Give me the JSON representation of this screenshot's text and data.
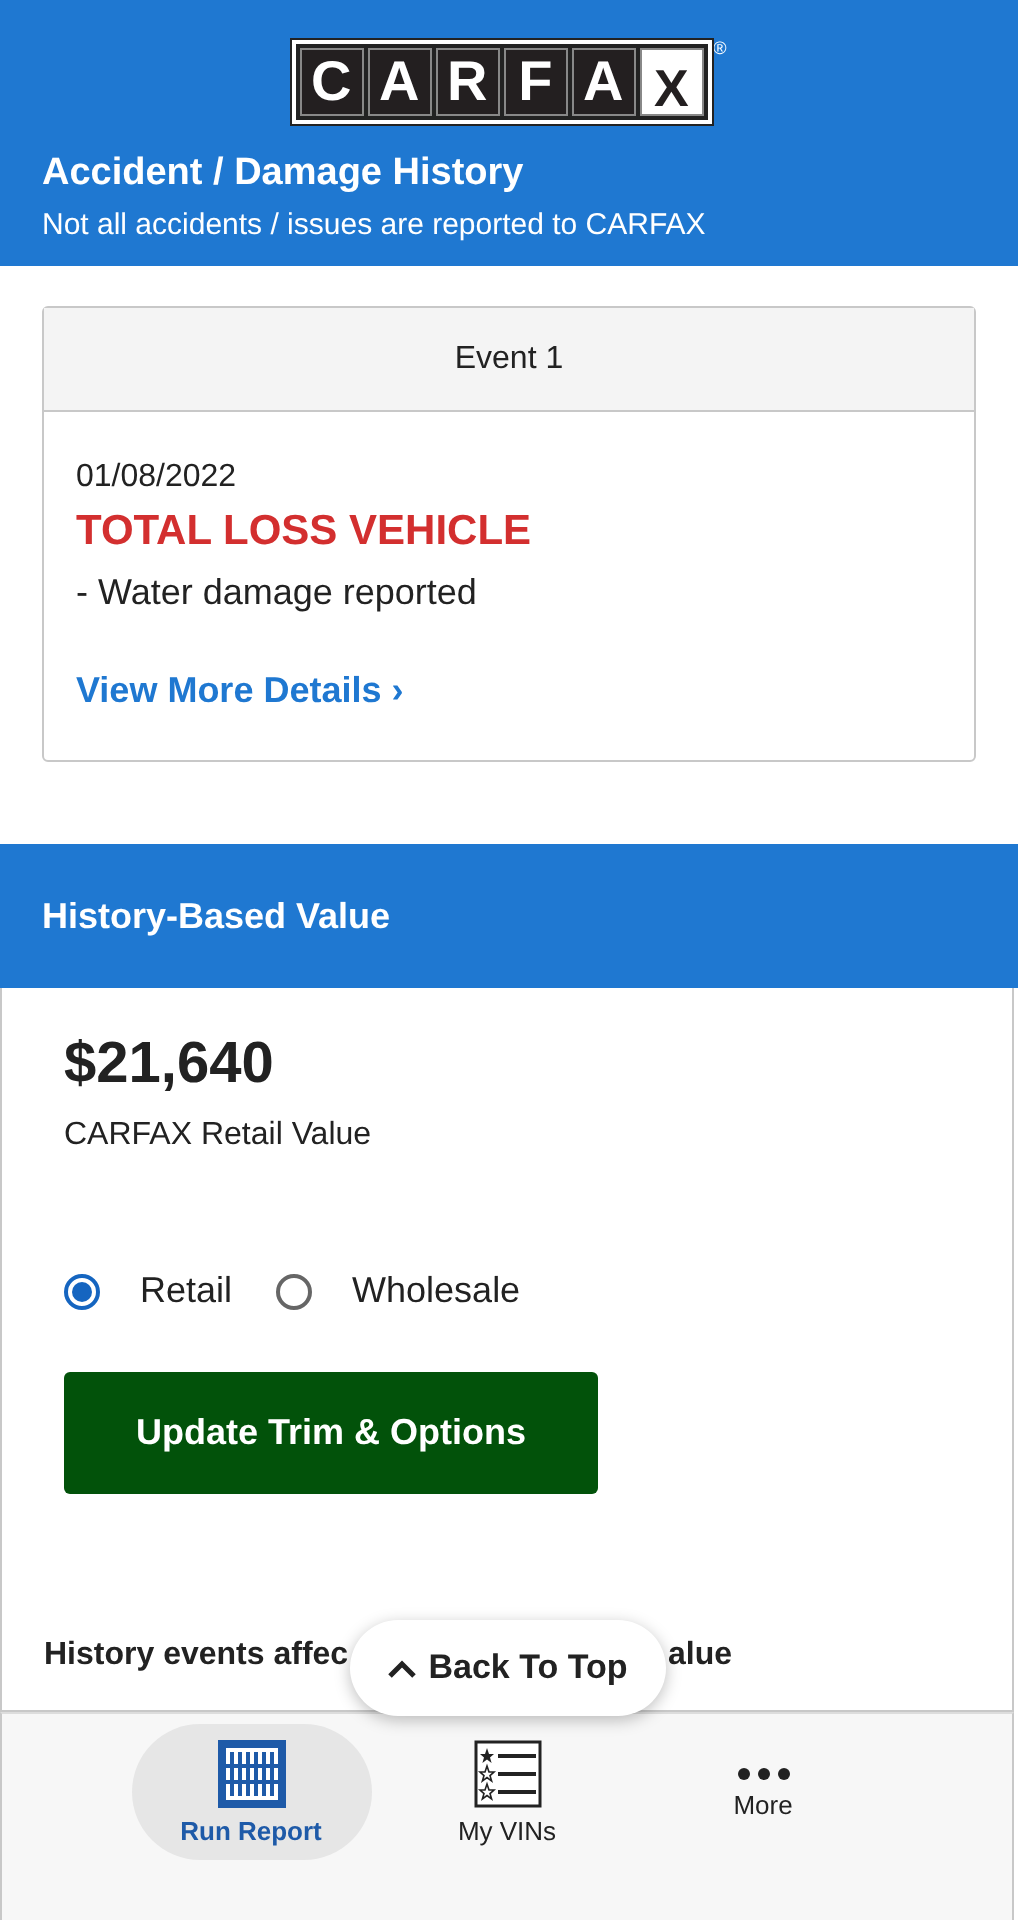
{
  "logo": {
    "letters": [
      "C",
      "A",
      "R",
      "F",
      "A",
      "X"
    ],
    "mark": "®"
  },
  "header": {
    "title": "Accident / Damage History",
    "subtitle": "Not all accidents / issues are reported to CARFAX"
  },
  "event": {
    "heading": "Event 1",
    "date": "01/08/2022",
    "status": "TOTAL LOSS VEHICLE",
    "detail": "- Water damage reported",
    "link": "View More Details",
    "link_icon": "›"
  },
  "value_section": {
    "title": "History-Based Value",
    "price": "$21,640",
    "price_label": "CARFAX Retail Value",
    "options": [
      {
        "label": "Retail",
        "selected": true
      },
      {
        "label": "Wholesale",
        "selected": false
      }
    ],
    "button": "Update Trim & Options",
    "events_heading_left": "History events affec",
    "events_heading_right": "alue"
  },
  "back_to_top": "Back To Top",
  "tabs": [
    {
      "label": "Run Report",
      "kind": "report",
      "selected": true
    },
    {
      "label": "My VINs",
      "kind": "list",
      "selected": false
    },
    {
      "label": "More",
      "kind": "more",
      "selected": false
    }
  ]
}
